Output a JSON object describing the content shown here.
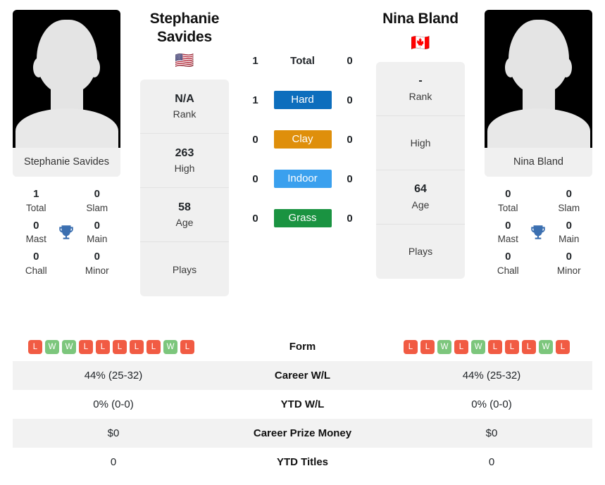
{
  "players": {
    "left": {
      "name": "Stephanie\nSavides",
      "name_flat": "Stephanie Savides",
      "photo_caption": "Stephanie\nSavides",
      "flag": "🇺🇸",
      "flag_name": "flag-united-states",
      "info": [
        {
          "value": "N/A",
          "label": "Rank"
        },
        {
          "value": "263",
          "label": "High"
        },
        {
          "value": "58",
          "label": "Age"
        },
        {
          "value": "",
          "label": "Plays"
        }
      ],
      "titles": {
        "total": "1",
        "total_label": "Total",
        "slam": "0",
        "slam_label": "Slam",
        "mast": "0",
        "mast_label": "Mast",
        "main": "0",
        "main_label": "Main",
        "chall": "0",
        "chall_label": "Chall",
        "minor": "0",
        "minor_label": "Minor"
      },
      "form": [
        "L",
        "W",
        "W",
        "L",
        "L",
        "L",
        "L",
        "L",
        "W",
        "L"
      ],
      "career_wl": "44% (25-32)",
      "ytd_wl": "0% (0-0)",
      "career_prize_money": "$0",
      "ytd_titles": "0"
    },
    "right": {
      "name": "Nina Bland",
      "name_flat": "Nina Bland",
      "photo_caption": "Nina Bland",
      "flag": "🇨🇦",
      "flag_name": "flag-canada",
      "info": [
        {
          "value": "-",
          "label": "Rank"
        },
        {
          "value": "",
          "label": "High"
        },
        {
          "value": "64",
          "label": "Age"
        },
        {
          "value": "",
          "label": "Plays"
        }
      ],
      "titles": {
        "total": "0",
        "total_label": "Total",
        "slam": "0",
        "slam_label": "Slam",
        "mast": "0",
        "mast_label": "Mast",
        "main": "0",
        "main_label": "Main",
        "chall": "0",
        "chall_label": "Chall",
        "minor": "0",
        "minor_label": "Minor"
      },
      "form": [
        "L",
        "L",
        "W",
        "L",
        "W",
        "L",
        "L",
        "L",
        "W",
        "L"
      ],
      "career_wl": "44% (25-32)",
      "ytd_wl": "0% (0-0)",
      "career_prize_money": "$0",
      "ytd_titles": "0"
    }
  },
  "head_to_head": {
    "total": {
      "label": "Total",
      "left": "1",
      "right": "0"
    },
    "surfaces": [
      {
        "label": "Hard",
        "left": "1",
        "right": "0",
        "color": "#0d6ebd"
      },
      {
        "label": "Clay",
        "left": "0",
        "right": "0",
        "color": "#df8f0b"
      },
      {
        "label": "Indoor",
        "left": "0",
        "right": "0",
        "color": "#3aa0ee"
      },
      {
        "label": "Grass",
        "left": "0",
        "right": "0",
        "color": "#1a9341"
      }
    ]
  },
  "table_rows": [
    {
      "label": "Form",
      "type": "form"
    },
    {
      "label": "Career W/L",
      "type": "text",
      "key": "career_wl"
    },
    {
      "label": "YTD W/L",
      "type": "text",
      "key": "ytd_wl"
    },
    {
      "label": "Career Prize Money",
      "type": "text",
      "key": "career_prize_money"
    },
    {
      "label": "YTD Titles",
      "type": "text",
      "key": "ytd_titles"
    }
  ],
  "colors": {
    "win": "#7cc67c",
    "loss": "#f15b43",
    "trophy": "#3b6fb0",
    "card_bg": "#f0f0f0",
    "row_shaded": "#f2f2f2"
  }
}
